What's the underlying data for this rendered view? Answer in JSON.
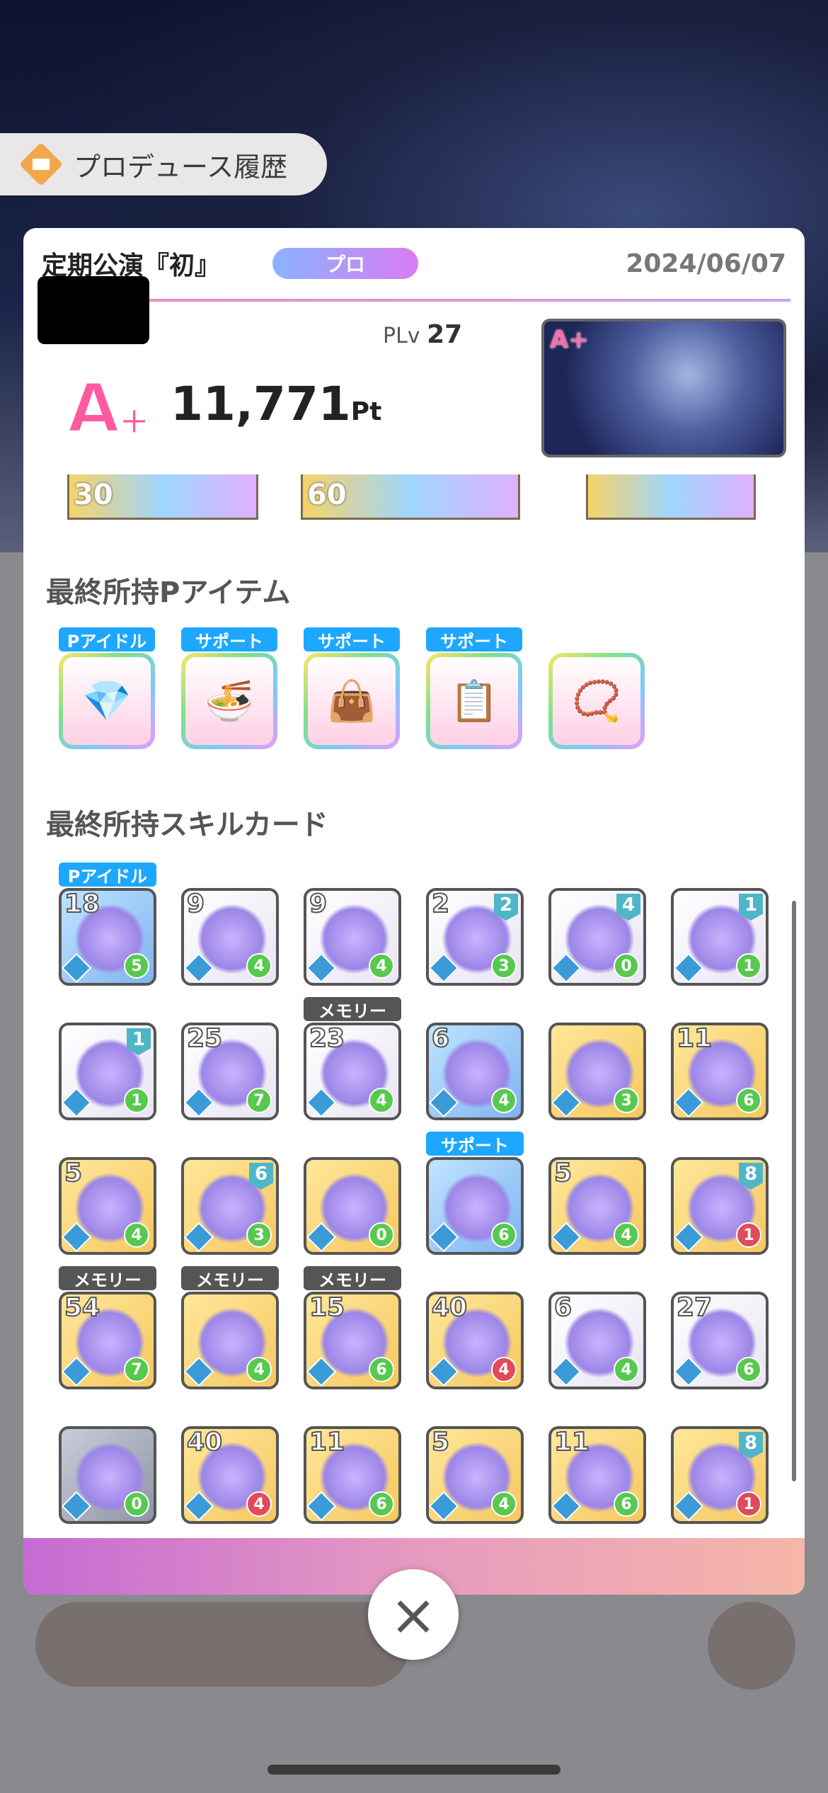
{
  "header": {
    "history_title": "プロデュース履歴"
  },
  "panel": {
    "event_title": "定期公演『初』",
    "difficulty": "プロ",
    "date": "2024/06/07",
    "plv_label": "PLv",
    "plv_value": "27",
    "rank": "A+",
    "score": "11,771",
    "score_unit": "Pt",
    "thumb_rank": "A+"
  },
  "cut_row": {
    "left_value": "30",
    "mid_value": "60"
  },
  "items_section": {
    "title": "最終所持Pアイテム",
    "items": [
      {
        "tag": "Pアイドル",
        "icon": "earring-icon"
      },
      {
        "tag": "サポート",
        "icon": "ramen-icon"
      },
      {
        "tag": "サポート",
        "icon": "bag-icon"
      },
      {
        "tag": "サポート",
        "icon": "clipboard-icon"
      },
      {
        "tag": "",
        "icon": "bracelet-icon"
      }
    ]
  },
  "cards_section": {
    "title": "最終所持スキルカード",
    "cards": [
      {
        "tag": "Pアイドル",
        "num": "18",
        "cost": "5",
        "style": "blue"
      },
      {
        "num": "9",
        "cost": "4",
        "style": "white"
      },
      {
        "num": "9",
        "cost": "4",
        "style": "white"
      },
      {
        "num": "2",
        "lv": "2",
        "cost": "3",
        "style": "white"
      },
      {
        "lv": "4",
        "cost": "0",
        "style": "white"
      },
      {
        "lv": "1",
        "cost": "1",
        "style": "white"
      },
      {
        "lv": "1",
        "cost": "1",
        "style": "white"
      },
      {
        "num": "25",
        "cost": "7",
        "style": "white"
      },
      {
        "tag": "メモリー",
        "num": "23",
        "cost": "4",
        "style": "white"
      },
      {
        "num": "6",
        "cost": "4",
        "style": "blue"
      },
      {
        "cost": "3",
        "style": "gold"
      },
      {
        "num": "11",
        "cost": "6",
        "style": "gold"
      },
      {
        "num": "5",
        "cost": "4",
        "style": "gold"
      },
      {
        "lv": "6",
        "cost": "3",
        "style": "gold"
      },
      {
        "cost": "0",
        "style": "gold"
      },
      {
        "tag": "サポート",
        "cost": "6",
        "style": "blue"
      },
      {
        "num": "5",
        "cost": "4",
        "style": "gold"
      },
      {
        "lv": "8",
        "cost": "1",
        "style": "gold",
        "red": true
      },
      {
        "tag": "メモリー",
        "num": "54",
        "cost": "7",
        "style": "gold"
      },
      {
        "tag": "メモリー",
        "cost": "4",
        "style": "gold"
      },
      {
        "tag": "メモリー",
        "num": "15",
        "cost": "6",
        "style": "gold"
      },
      {
        "num": "40",
        "cost": "4",
        "style": "gold",
        "red": true
      },
      {
        "num": "6",
        "cost": "4",
        "style": "white"
      },
      {
        "num": "27",
        "cost": "6",
        "style": "white"
      },
      {
        "cost": "0",
        "style": "gray"
      },
      {
        "num": "40",
        "cost": "4",
        "style": "gold",
        "red": true
      },
      {
        "num": "11",
        "cost": "6",
        "style": "gold"
      },
      {
        "num": "5",
        "cost": "4",
        "style": "gold"
      },
      {
        "num": "11",
        "cost": "6",
        "style": "gold"
      },
      {
        "lv": "8",
        "cost": "1",
        "style": "gold",
        "red": true
      }
    ]
  },
  "footer": {
    "close_label": "×"
  },
  "colors": {
    "accent_pink": "#f08cb2",
    "accent_purple": "#c56bd4",
    "tag_blue": "#1ea7ff"
  }
}
